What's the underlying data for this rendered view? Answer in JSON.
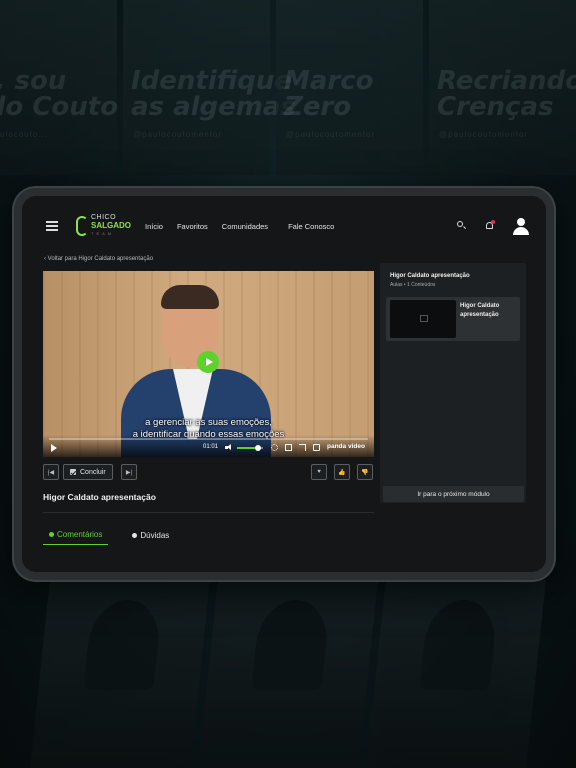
{
  "background": {
    "posters": [
      {
        "text": "a, sou\nulo Couto",
        "handle": "@paulocouto..."
      },
      {
        "text": "Identifique\nas algemas",
        "handle": "@paulocoutomentor"
      },
      {
        "text": "Marco\nZero",
        "handle": "@paulocoutomentor"
      },
      {
        "text": "Recriando\nCrenças",
        "handle": "@paulocoutomentor"
      }
    ]
  },
  "header": {
    "logo": {
      "line1": "CHICO",
      "line2": "SALGADO",
      "line3": "TEAM"
    },
    "nav": [
      "Início",
      "Favoritos",
      "Comunidades",
      "Fale Conosco"
    ]
  },
  "back_link": "‹ Voltar para Higor Caldato apresentação",
  "video": {
    "caption_line1": "a gerenciar as suas emoções,",
    "caption_line2": "a identificar quando essas emoções",
    "time": "01:01",
    "brand": "panda video",
    "volume": 0.8,
    "accent": "#5ed12d"
  },
  "actions": {
    "prev": "|◀",
    "conclude": "Concluir",
    "next": "▶|",
    "favorite": "♥",
    "like": "👍",
    "dislike": "👎"
  },
  "lesson_title": "Higor Caldato apresentação",
  "tabs": [
    {
      "label": "Comentários",
      "active": true
    },
    {
      "label": "Dúvidas",
      "active": false
    }
  ],
  "sidebar": {
    "title": "Higor Caldato apresentação",
    "subtitle": "Aulas • 1 Conteúdos",
    "item_title": "Higor Caldato apresentação",
    "next_button": "Ir para o próximo módulo"
  }
}
